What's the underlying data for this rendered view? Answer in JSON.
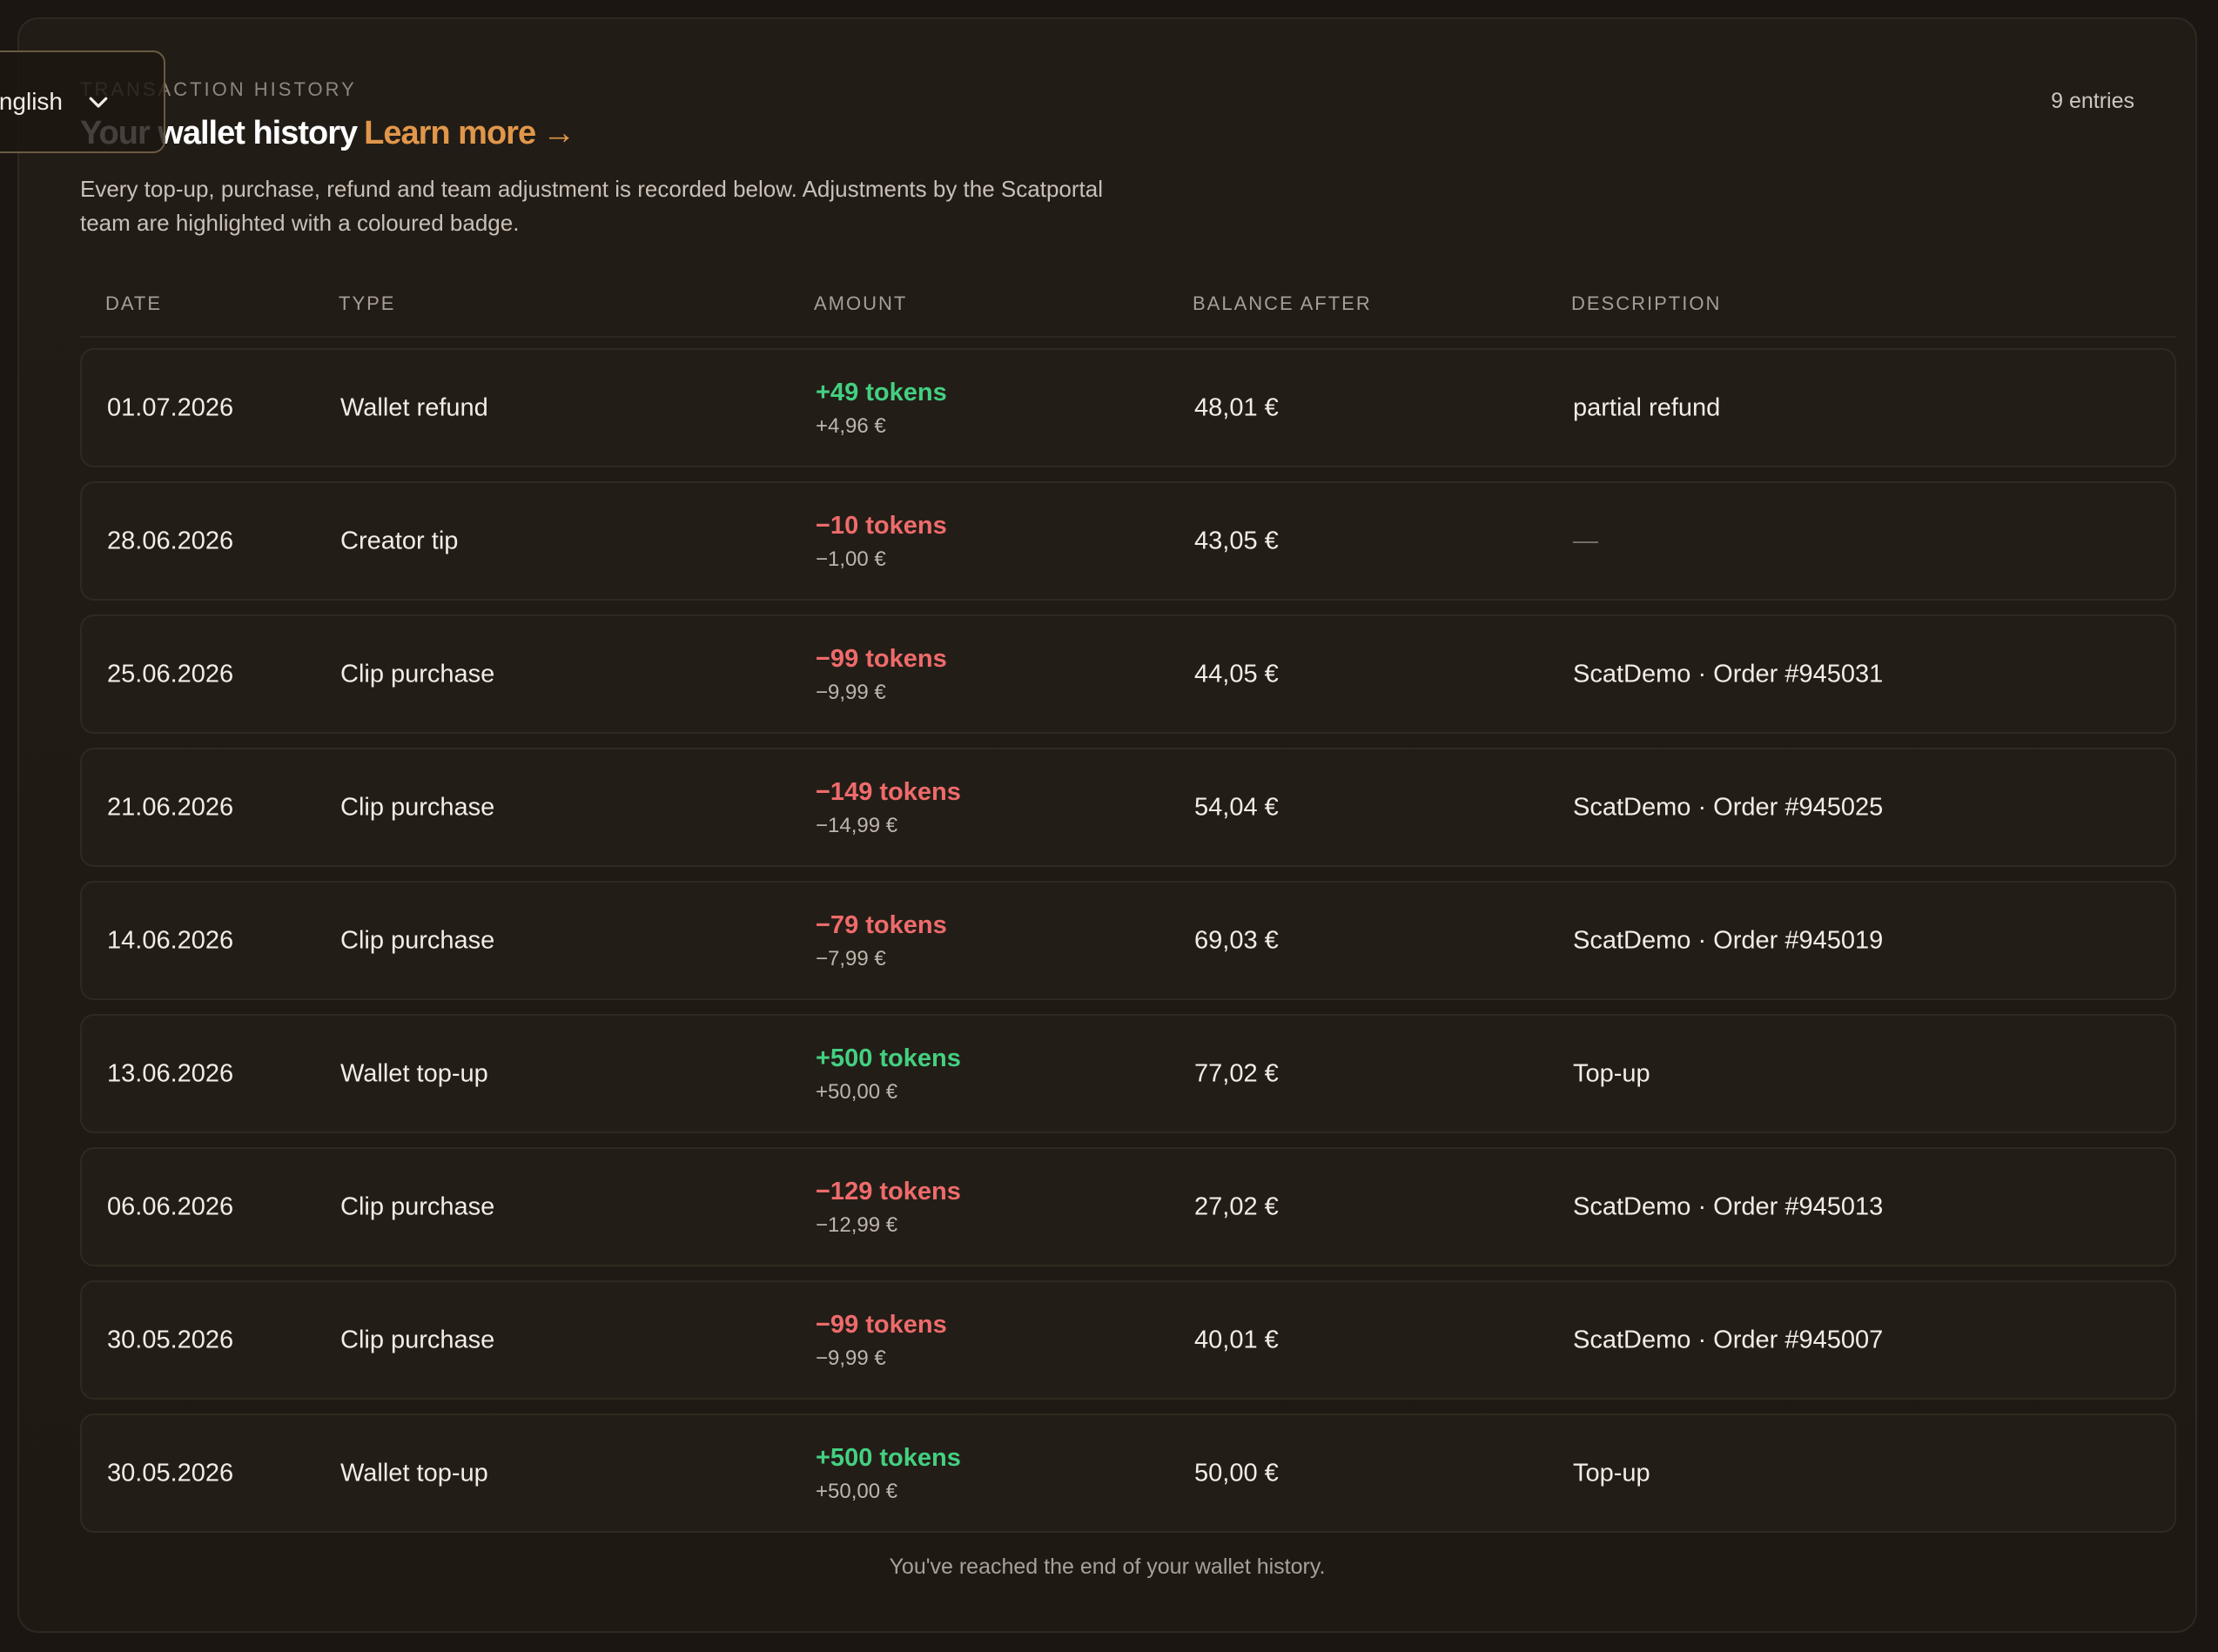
{
  "language": {
    "label": "nglish"
  },
  "header": {
    "eyebrow": "TRANSACTION HISTORY",
    "title": "Your wallet history",
    "learn_more": "Learn more",
    "arrow": "→",
    "entries": "9 entries",
    "intro": "Every top-up, purchase, refund and team adjustment is recorded below. Adjustments by the Scatportal team are highlighted with a coloured badge."
  },
  "table": {
    "columns": {
      "date": "DATE",
      "type": "TYPE",
      "amount": "AMOUNT",
      "balance": "BALANCE AFTER",
      "description": "DESCRIPTION"
    },
    "rows": [
      {
        "date": "01.07.2026",
        "type": "Wallet refund",
        "tokens": "+49 tokens",
        "euro": "+4,96 €",
        "balance": "48,01 €",
        "description": "partial refund",
        "direction": "pos"
      },
      {
        "date": "28.06.2026",
        "type": "Creator tip",
        "tokens": "−10 tokens",
        "euro": "−1,00 €",
        "balance": "43,05 €",
        "description": "—",
        "direction": "neg"
      },
      {
        "date": "25.06.2026",
        "type": "Clip purchase",
        "tokens": "−99 tokens",
        "euro": "−9,99 €",
        "balance": "44,05 €",
        "description": "ScatDemo · Order #945031",
        "direction": "neg"
      },
      {
        "date": "21.06.2026",
        "type": "Clip purchase",
        "tokens": "−149 tokens",
        "euro": "−14,99 €",
        "balance": "54,04 €",
        "description": "ScatDemo · Order #945025",
        "direction": "neg"
      },
      {
        "date": "14.06.2026",
        "type": "Clip purchase",
        "tokens": "−79 tokens",
        "euro": "−7,99 €",
        "balance": "69,03 €",
        "description": "ScatDemo · Order #945019",
        "direction": "neg"
      },
      {
        "date": "13.06.2026",
        "type": "Wallet top-up",
        "tokens": "+500 tokens",
        "euro": "+50,00 €",
        "balance": "77,02 €",
        "description": "Top-up",
        "direction": "pos"
      },
      {
        "date": "06.06.2026",
        "type": "Clip purchase",
        "tokens": "−129 tokens",
        "euro": "−12,99 €",
        "balance": "27,02 €",
        "description": "ScatDemo · Order #945013",
        "direction": "neg"
      },
      {
        "date": "30.05.2026",
        "type": "Clip purchase",
        "tokens": "−99 tokens",
        "euro": "−9,99 €",
        "balance": "40,01 €",
        "description": "ScatDemo · Order #945007",
        "direction": "neg"
      },
      {
        "date": "30.05.2026",
        "type": "Wallet top-up",
        "tokens": "+500 tokens",
        "euro": "+50,00 €",
        "balance": "50,00 €",
        "description": "Top-up",
        "direction": "pos"
      }
    ]
  },
  "footer": {
    "end_message": "You've reached the end of your wallet history."
  },
  "colors": {
    "positive": "#43d081",
    "negative": "#ef6b6b",
    "accent": "#e0974a",
    "background": "#1b1611"
  }
}
